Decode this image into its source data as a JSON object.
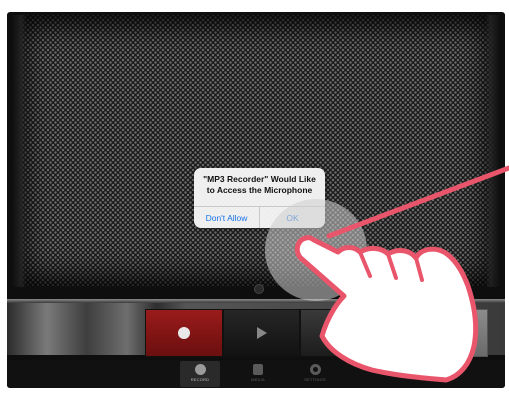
{
  "app": {
    "name": "MP3 Recorder"
  },
  "dialog": {
    "message_line1": "\"MP3 Recorder\" Would Like",
    "message_line2": "to Access the Microphone",
    "deny_label": "Don't Allow",
    "allow_label": "OK"
  },
  "transport": {
    "buttons": [
      {
        "name": "record",
        "icon": "record-dot-icon"
      },
      {
        "name": "play",
        "icon": "play-icon"
      },
      {
        "name": "stop",
        "icon": "stop-icon"
      }
    ]
  },
  "tabs": [
    {
      "label": "RECORD",
      "icon": "record-circle-icon",
      "selected": true
    },
    {
      "label": "MEDIA",
      "icon": "media-square-icon",
      "selected": false
    },
    {
      "label": "SETTINGS",
      "icon": "gear-icon",
      "selected": false
    }
  ],
  "colors": {
    "record_accent": "#8a1616",
    "link_blue": "#1a73e8",
    "highlight_pink": "#e9566b"
  },
  "annotation": {
    "gesture": "tap-hand-icon",
    "target": "OK"
  }
}
